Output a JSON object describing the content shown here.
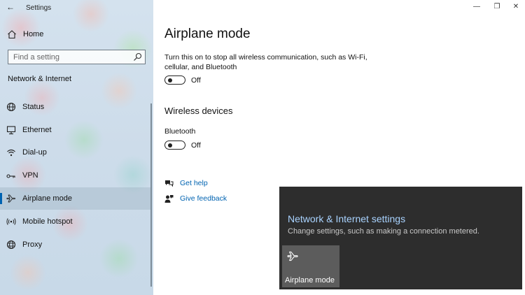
{
  "window": {
    "title": "Settings"
  },
  "sidebar": {
    "home_label": "Home",
    "search_placeholder": "Find a setting",
    "section_label": "Network & Internet",
    "items": [
      {
        "label": "Status",
        "icon": "status-icon",
        "selected": false
      },
      {
        "label": "Ethernet",
        "icon": "ethernet-icon",
        "selected": false
      },
      {
        "label": "Dial-up",
        "icon": "dialup-icon",
        "selected": false
      },
      {
        "label": "VPN",
        "icon": "vpn-icon",
        "selected": false
      },
      {
        "label": "Airplane mode",
        "icon": "airplane-icon",
        "selected": true
      },
      {
        "label": "Mobile hotspot",
        "icon": "hotspot-icon",
        "selected": false
      },
      {
        "label": "Proxy",
        "icon": "proxy-icon",
        "selected": false
      }
    ]
  },
  "main": {
    "title": "Airplane mode",
    "description": "Turn this on to stop all wireless communication, such as Wi-Fi, cellular, and Bluetooth",
    "airplane_toggle_state": "Off",
    "wireless_heading": "Wireless devices",
    "bluetooth_label": "Bluetooth",
    "bluetooth_toggle_state": "Off",
    "links": [
      {
        "label": "Get help",
        "icon": "help-icon"
      },
      {
        "label": "Give feedback",
        "icon": "feedback-icon"
      }
    ]
  },
  "flyout": {
    "title": "Network & Internet settings",
    "description": "Change settings, such as making a connection metered.",
    "tile_label": "Airplane mode"
  },
  "colors": {
    "accent": "#0063b1",
    "flyout_bg": "#2d2d2d",
    "flyout_link": "#a9d3ff"
  }
}
